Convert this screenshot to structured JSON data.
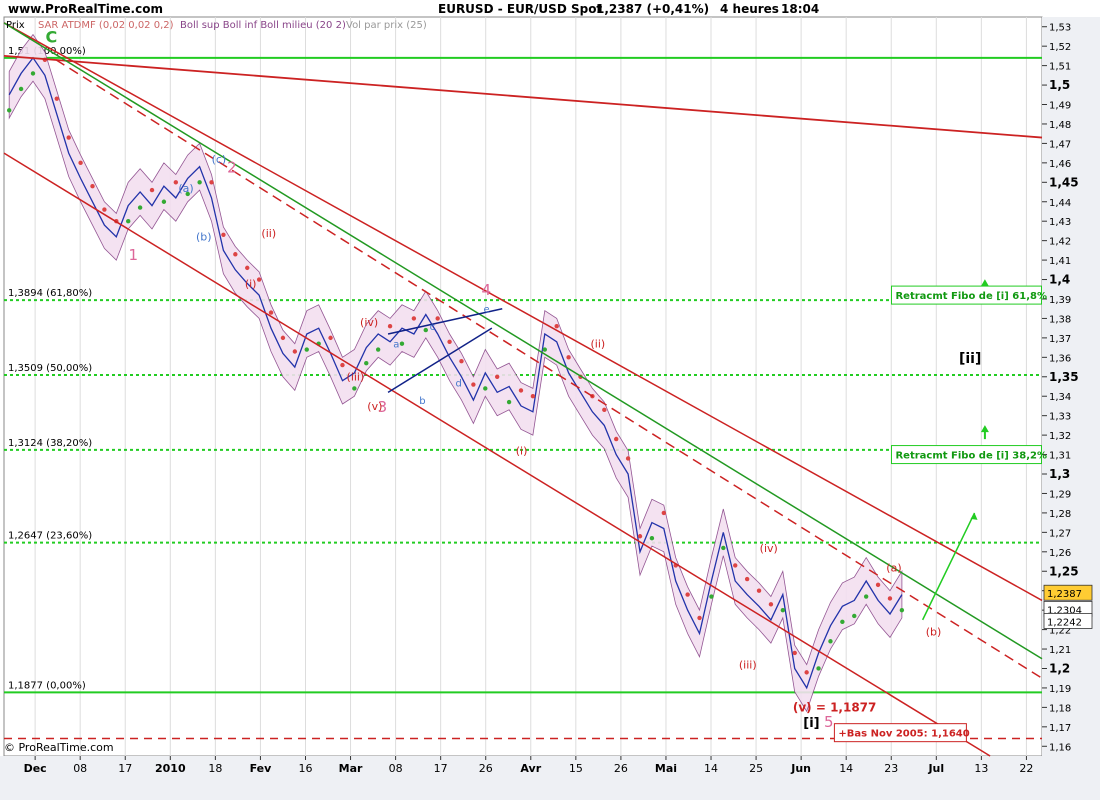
{
  "header": {
    "site": "www.ProRealTime.com",
    "title": "EURUSD - EUR/USD Spot",
    "price": "1,2387 (+0,41%)",
    "timeframe": "4 heures",
    "time": "18:04"
  },
  "legend": {
    "prix": "Prix",
    "sar": "SAR ATDMF (0,02 0,02 0,2)",
    "boll": "Boll sup Boll inf Boll milieu (20 2)",
    "vol": "Vol par prix (25)"
  },
  "footer": {
    "copyright": "© ProRealTime.com"
  },
  "colors": {
    "fibo_line": "#22cc22",
    "channel": "#cc2222",
    "trend_green": "#229922",
    "bollinger": "#884488",
    "wave_pink": "#dd6699",
    "wave_red": "#cc2222",
    "wave_blue": "#4477cc",
    "price_blue": "#2233aa"
  },
  "chart_data": {
    "type": "line",
    "title": "EURUSD - EUR/USD Spot",
    "x_tick_labels": [
      "Dec",
      "08",
      "17",
      "2010",
      "18",
      "Fev",
      "16",
      "Mar",
      "08",
      "17",
      "26",
      "Avr",
      "15",
      "26",
      "Mai",
      "14",
      "25",
      "Jun",
      "14",
      "23",
      "Jul",
      "13",
      "22"
    ],
    "y_tick_labels": [
      "1,53",
      "1,52",
      "1,51",
      "1,5",
      "1,49",
      "1,48",
      "1,47",
      "1,46",
      "1,45",
      "1,44",
      "1,43",
      "1,42",
      "1,41",
      "1,4",
      "1,39",
      "1,38",
      "1,37",
      "1,36",
      "1,35",
      "1,34",
      "1,33",
      "1,32",
      "1,31",
      "1,3",
      "1,29",
      "1,28",
      "1,27",
      "1,26",
      "1,25",
      "1,24",
      "1,23",
      "1,22",
      "1,21",
      "1,2",
      "1,19",
      "1,18",
      "1,17",
      "1,16"
    ],
    "ylim": [
      1.155,
      1.535
    ],
    "bold_y_ticks": [
      "1,5",
      "1,45",
      "1,4",
      "1,35",
      "1,3",
      "1,25",
      "1,2"
    ],
    "series": [
      {
        "values": [
          1.495,
          1.506,
          1.514,
          1.505,
          1.485,
          1.465,
          1.452,
          1.44,
          1.428,
          1.422,
          1.438,
          1.445,
          1.438,
          1.448,
          1.442,
          1.452,
          1.458,
          1.442,
          1.415,
          1.405,
          1.398,
          1.392,
          1.375,
          1.362,
          1.355,
          1.372,
          1.375,
          1.362,
          1.348,
          1.352,
          1.365,
          1.372,
          1.368,
          1.375,
          1.372,
          1.382,
          1.372,
          1.36,
          1.35,
          1.338,
          1.352,
          1.342,
          1.345,
          1.335,
          1.332,
          1.372,
          1.368,
          1.352,
          1.342,
          1.332,
          1.325,
          1.31,
          1.3,
          1.26,
          1.275,
          1.272,
          1.245,
          1.23,
          1.218,
          1.245,
          1.27,
          1.245,
          1.238,
          1.232,
          1.225,
          1.238,
          1.2,
          1.19,
          1.208,
          1.222,
          1.232,
          1.235,
          1.245,
          1.235,
          1.228,
          1.238
        ]
      }
    ],
    "fibo_levels": [
      {
        "label": "1,51 (100,00%)",
        "value": 1.514
      },
      {
        "label": "1,3894 (61,80%)",
        "value": 1.3894
      },
      {
        "label": "1,3509 (50,00%)",
        "value": 1.3509
      },
      {
        "label": "1,3124 (38,20%)",
        "value": 1.3124
      },
      {
        "label": "1,2647 (23,60%)",
        "value": 1.2647
      },
      {
        "label": "1,1877 (0,00%)",
        "value": 1.1877
      }
    ],
    "price_boxes": [
      {
        "label": "1,2387",
        "value": 1.2387,
        "fill": "#ffcc33"
      },
      {
        "label": "1,2304",
        "value": 1.2304,
        "fill": "#ffffff"
      },
      {
        "label": "1,2242",
        "value": 1.2242,
        "fill": "#ffffff"
      }
    ],
    "bas_level": 1.164,
    "annotations": {
      "wave_c": "C",
      "wave_1": "1",
      "wave_2": "2",
      "wave_3": "3",
      "wave_4": "4",
      "wave_5": "5",
      "lbl_a": "(a)",
      "lbl_b": "(b)",
      "lbl_c": "(c)",
      "lbl_i1": "(i)",
      "lbl_ii1": "(ii)",
      "lbl_iii1": "(iii)",
      "lbl_iv1": "(iv)",
      "lbl_v1": "(v)",
      "lbl_i2": "(i)",
      "lbl_ii2": "(ii)",
      "lbl_iii2": "(iii)",
      "lbl_iv2": "(iv)",
      "lbl_v2": "(v) = 1,1877",
      "lbl_a2": "(a)",
      "lbl_b2": "(b)",
      "tri_a": "a",
      "tri_b": "b",
      "tri_c": "c",
      "tri_d": "d",
      "tri_e": "e",
      "big_i": "[i]",
      "big_ii": "[ii]",
      "fibo_box_618": "Retracmt Fibo de [i] 61,8%",
      "fibo_box_382": "Retracmt Fibo de [i] 38,2%",
      "bas_box": "+Bas Nov 2005: 1,1640"
    }
  }
}
